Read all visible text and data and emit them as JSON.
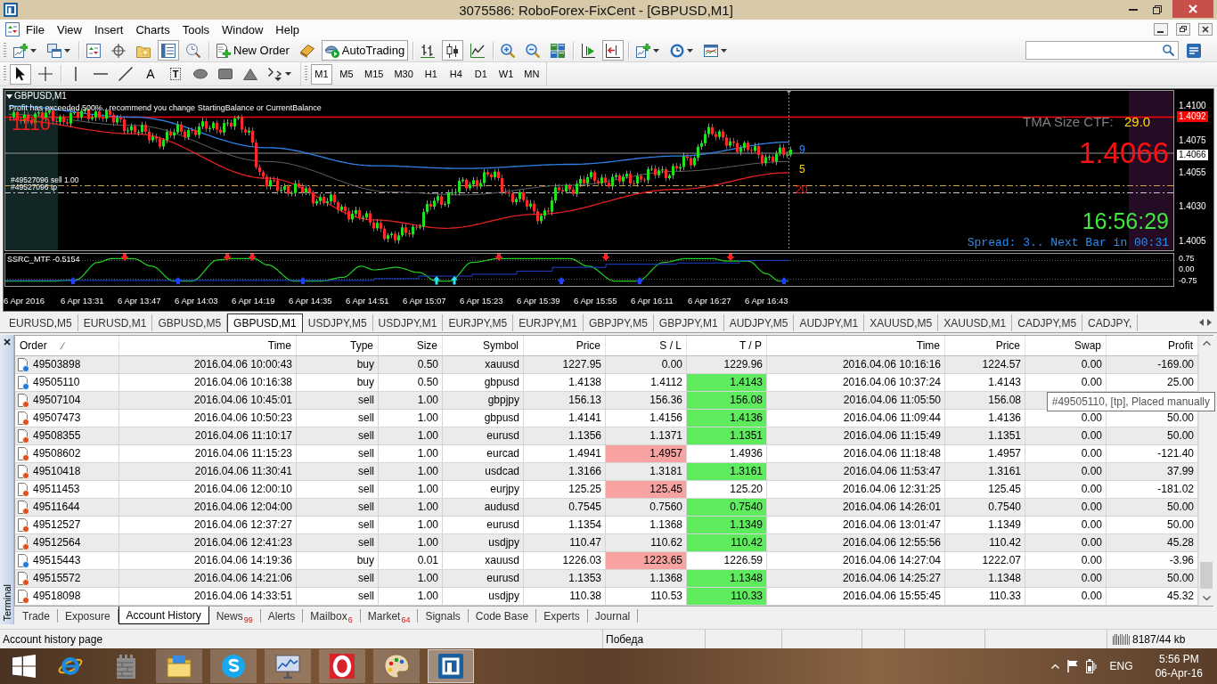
{
  "window": {
    "title": "3075586: RoboForex-FixCent - [GBPUSD,M1]"
  },
  "menu": [
    "File",
    "View",
    "Insert",
    "Charts",
    "Tools",
    "Window",
    "Help"
  ],
  "toolbar": [
    {
      "kind": "new-chart",
      "pressed": false
    },
    {
      "kind": "profiles",
      "pressed": false
    },
    {
      "kind": "separator"
    },
    {
      "kind": "market-watch",
      "pressed": false
    },
    {
      "kind": "navigator",
      "pressed": false
    },
    {
      "kind": "favorites",
      "pressed": false
    },
    {
      "kind": "terminal",
      "pressed": true
    },
    {
      "kind": "tester",
      "pressed": false
    },
    {
      "kind": "separator"
    },
    {
      "kind": "new-order",
      "label": "New Order",
      "pressed": false
    },
    {
      "kind": "editor",
      "pressed": false
    },
    {
      "kind": "autotrading",
      "label": "AutoTrading",
      "pressed": true
    },
    {
      "kind": "separator"
    },
    {
      "kind": "bar-chart",
      "pressed": false
    },
    {
      "kind": "candle-chart",
      "pressed": true
    },
    {
      "kind": "line-chart",
      "pressed": false
    },
    {
      "kind": "separator"
    },
    {
      "kind": "zoom-in",
      "pressed": false
    },
    {
      "kind": "zoom-out",
      "pressed": false
    },
    {
      "kind": "tile",
      "pressed": false
    },
    {
      "kind": "separator"
    },
    {
      "kind": "autoscroll",
      "pressed": false
    },
    {
      "kind": "chart-shift",
      "pressed": true
    },
    {
      "kind": "separator"
    },
    {
      "kind": "indicators",
      "pressed": false
    },
    {
      "kind": "periods",
      "pressed": false
    },
    {
      "kind": "templates",
      "pressed": false
    }
  ],
  "drawing_tools": [
    {
      "kind": "cursor",
      "pressed": true
    },
    {
      "kind": "crosshair",
      "pressed": false
    },
    {
      "kind": "separator"
    },
    {
      "kind": "vline",
      "pressed": false
    },
    {
      "kind": "hline",
      "pressed": false
    },
    {
      "kind": "trendline",
      "pressed": false
    },
    {
      "kind": "text",
      "label": "A",
      "pressed": false
    },
    {
      "kind": "label",
      "label": "T",
      "pressed": false
    },
    {
      "kind": "ellipse",
      "pressed": false
    },
    {
      "kind": "rectangle",
      "pressed": false
    },
    {
      "kind": "triangle",
      "pressed": false
    },
    {
      "kind": "arrows",
      "pressed": false
    }
  ],
  "timeframes": [
    {
      "label": "M1",
      "selected": true
    },
    {
      "label": "M5",
      "selected": false
    },
    {
      "label": "M15",
      "selected": false
    },
    {
      "label": "M30",
      "selected": false
    },
    {
      "label": "H1",
      "selected": false
    },
    {
      "label": "H4",
      "selected": false
    },
    {
      "label": "D1",
      "selected": false
    },
    {
      "label": "W1",
      "selected": false
    },
    {
      "label": "MN",
      "selected": false
    }
  ],
  "chart": {
    "symbol": "GBPUSD,M1",
    "message": "Profit has exceeded 500%...recommend you change StartingBalance or CurrentBalance",
    "corner_value": "1110",
    "order_labels": [
      "#49527096 sell 1.00",
      "#49527096 tp"
    ],
    "ma_labels": [
      {
        "text": "9",
        "color": "#3a8ee8"
      },
      {
        "text": "5",
        "color": "#f0d020"
      },
      {
        "text": "20",
        "color": "#e82020"
      }
    ],
    "tma_label": "TMA Size CTF:",
    "tma_value": "29.0",
    "price": "1.4066",
    "clock": "16:56:29",
    "spread": "Spread: 3.. Next Bar in 00:31",
    "price_axis": [
      {
        "text": "1.4100",
        "kind": "tick"
      },
      {
        "text": "1.4092",
        "kind": "line"
      },
      {
        "text": "1.4075",
        "kind": "tick"
      },
      {
        "text": "1.4066",
        "kind": "bid"
      },
      {
        "text": "1.4055",
        "kind": "tick"
      },
      {
        "text": "1.4030",
        "kind": "tick"
      },
      {
        "text": "1.4005",
        "kind": "tick"
      }
    ],
    "indicator": {
      "name": "SSRC_MTF -0.5154",
      "axis": [
        "0.75",
        "0.00",
        "-0.75"
      ]
    },
    "time_axis": [
      "6 Apr 2016",
      "6 Apr 13:31",
      "6 Apr 13:47",
      "6 Apr 14:03",
      "6 Apr 14:19",
      "6 Apr 14:35",
      "6 Apr 14:51",
      "6 Apr 15:07",
      "6 Apr 15:23",
      "6 Apr 15:39",
      "6 Apr 15:55",
      "6 Apr 16:11",
      "6 Apr 16:27",
      "6 Apr 16:43"
    ]
  },
  "chart_tabs": [
    {
      "label": "EURUSD,M5",
      "selected": false
    },
    {
      "label": "EURUSD,M1",
      "selected": false
    },
    {
      "label": "GBPUSD,M5",
      "selected": false
    },
    {
      "label": "GBPUSD,M1",
      "selected": true
    },
    {
      "label": "USDJPY,M5",
      "selected": false
    },
    {
      "label": "USDJPY,M1",
      "selected": false
    },
    {
      "label": "EURJPY,M5",
      "selected": false
    },
    {
      "label": "EURJPY,M1",
      "selected": false
    },
    {
      "label": "GBPJPY,M5",
      "selected": false
    },
    {
      "label": "GBPJPY,M1",
      "selected": false
    },
    {
      "label": "AUDJPY,M5",
      "selected": false
    },
    {
      "label": "AUDJPY,M1",
      "selected": false
    },
    {
      "label": "XAUUSD,M5",
      "selected": false
    },
    {
      "label": "XAUUSD,M1",
      "selected": false
    },
    {
      "label": "CADJPY,M5",
      "selected": false
    },
    {
      "label": "CADJPY,",
      "selected": false
    }
  ],
  "terminal": {
    "title": "Terminal",
    "columns": [
      "Order",
      "Time",
      "Type",
      "Size",
      "Symbol",
      "Price",
      "S / L",
      "T / P",
      "Time",
      "Price",
      "Swap",
      "Profit"
    ],
    "rows": [
      {
        "kind": "buy",
        "order": "49503898",
        "open_time": "2016.04.06 10:00:43",
        "type": "buy",
        "size": "0.50",
        "symbol": "xauusd",
        "open_price": "1227.95",
        "sl": "0.00",
        "sl_hit": false,
        "tp": "1229.96",
        "tp_hit": false,
        "close_time": "2016.04.06 10:16:16",
        "close_price": "1224.57",
        "swap": "0.00",
        "profit": "-169.00"
      },
      {
        "kind": "buy",
        "order": "49505110",
        "open_time": "2016.04.06 10:16:38",
        "type": "buy",
        "size": "0.50",
        "symbol": "gbpusd",
        "open_price": "1.4138",
        "sl": "1.4112",
        "sl_hit": false,
        "tp": "1.4143",
        "tp_hit": true,
        "close_time": "2016.04.06 10:37:24",
        "close_price": "1.4143",
        "swap": "0.00",
        "profit": "25.00"
      },
      {
        "kind": "sell",
        "order": "49507104",
        "open_time": "2016.04.06 10:45:01",
        "type": "sell",
        "size": "1.00",
        "symbol": "gbpjpy",
        "open_price": "156.13",
        "sl": "156.36",
        "sl_hit": false,
        "tp": "156.08",
        "tp_hit": true,
        "close_time": "2016.04.06 11:05:50",
        "close_price": "156.08"
      },
      {
        "kind": "sell",
        "order": "49507473",
        "open_time": "2016.04.06 10:50:23",
        "type": "sell",
        "size": "1.00",
        "symbol": "gbpusd",
        "open_price": "1.4141",
        "sl": "1.4156",
        "sl_hit": false,
        "tp": "1.4136",
        "tp_hit": true,
        "close_time": "2016.04.06 11:09:44",
        "close_price": "1.4136",
        "swap": "0.00",
        "profit": "50.00"
      },
      {
        "kind": "sell",
        "order": "49508355",
        "open_time": "2016.04.06 11:10:17",
        "type": "sell",
        "size": "1.00",
        "symbol": "eurusd",
        "open_price": "1.1356",
        "sl": "1.1371",
        "sl_hit": false,
        "tp": "1.1351",
        "tp_hit": true,
        "close_time": "2016.04.06 11:15:49",
        "close_price": "1.1351",
        "swap": "0.00",
        "profit": "50.00"
      },
      {
        "kind": "sell",
        "order": "49508602",
        "open_time": "2016.04.06 11:15:23",
        "type": "sell",
        "size": "1.00",
        "symbol": "eurcad",
        "open_price": "1.4941",
        "sl": "1.4957",
        "sl_hit": true,
        "tp": "1.4936",
        "tp_hit": false,
        "close_time": "2016.04.06 11:18:48",
        "close_price": "1.4957",
        "swap": "0.00",
        "profit": "-121.40"
      },
      {
        "kind": "sell",
        "order": "49510418",
        "open_time": "2016.04.06 11:30:41",
        "type": "sell",
        "size": "1.00",
        "symbol": "usdcad",
        "open_price": "1.3166",
        "sl": "1.3181",
        "sl_hit": false,
        "tp": "1.3161",
        "tp_hit": true,
        "close_time": "2016.04.06 11:53:47",
        "close_price": "1.3161",
        "swap": "0.00",
        "profit": "37.99"
      },
      {
        "kind": "sell",
        "order": "49511453",
        "open_time": "2016.04.06 12:00:10",
        "type": "sell",
        "size": "1.00",
        "symbol": "eurjpy",
        "open_price": "125.25",
        "sl": "125.45",
        "sl_hit": true,
        "tp": "125.20",
        "tp_hit": false,
        "close_time": "2016.04.06 12:31:25",
        "close_price": "125.45",
        "swap": "0.00",
        "profit": "-181.02"
      },
      {
        "kind": "sell",
        "order": "49511644",
        "open_time": "2016.04.06 12:04:00",
        "type": "sell",
        "size": "1.00",
        "symbol": "audusd",
        "open_price": "0.7545",
        "sl": "0.7560",
        "sl_hit": false,
        "tp": "0.7540",
        "tp_hit": true,
        "close_time": "2016.04.06 14:26:01",
        "close_price": "0.7540",
        "swap": "0.00",
        "profit": "50.00"
      },
      {
        "kind": "sell",
        "order": "49512527",
        "open_time": "2016.04.06 12:37:27",
        "type": "sell",
        "size": "1.00",
        "symbol": "eurusd",
        "open_price": "1.1354",
        "sl": "1.1368",
        "sl_hit": false,
        "tp": "1.1349",
        "tp_hit": true,
        "close_time": "2016.04.06 13:01:47",
        "close_price": "1.1349",
        "swap": "0.00",
        "profit": "50.00"
      },
      {
        "kind": "sell",
        "order": "49512564",
        "open_time": "2016.04.06 12:41:23",
        "type": "sell",
        "size": "1.00",
        "symbol": "usdjpy",
        "open_price": "110.47",
        "sl": "110.62",
        "sl_hit": false,
        "tp": "110.42",
        "tp_hit": true,
        "close_time": "2016.04.06 12:55:56",
        "close_price": "110.42",
        "swap": "0.00",
        "profit": "45.28"
      },
      {
        "kind": "buy",
        "order": "49515443",
        "open_time": "2016.04.06 14:19:36",
        "type": "buy",
        "size": "0.01",
        "symbol": "xauusd",
        "open_price": "1226.03",
        "sl": "1223.65",
        "sl_hit": true,
        "tp": "1226.59",
        "tp_hit": false,
        "close_time": "2016.04.06 14:27:04",
        "close_price": "1222.07",
        "swap": "0.00",
        "profit": "-3.96"
      },
      {
        "kind": "sell",
        "order": "49515572",
        "open_time": "2016.04.06 14:21:06",
        "type": "sell",
        "size": "1.00",
        "symbol": "eurusd",
        "open_price": "1.1353",
        "sl": "1.1368",
        "sl_hit": false,
        "tp": "1.1348",
        "tp_hit": true,
        "close_time": "2016.04.06 14:25:27",
        "close_price": "1.1348",
        "swap": "0.00",
        "profit": "50.00"
      },
      {
        "kind": "sell",
        "order": "49518098",
        "open_time": "2016.04.06 14:33:51",
        "type": "sell",
        "size": "1.00",
        "symbol": "usdjpy",
        "open_price": "110.38",
        "sl": "110.53",
        "sl_hit": false,
        "tp": "110.33",
        "tp_hit": true,
        "close_time": "2016.04.06 15:55:45",
        "close_price": "110.33",
        "swap": "0.00",
        "profit": "45.32"
      }
    ],
    "tooltip": "#49505110, [tp], Placed manually",
    "tabs": [
      {
        "label": "Trade",
        "selected": false
      },
      {
        "label": "Exposure",
        "selected": false
      },
      {
        "label": "Account History",
        "selected": true
      },
      {
        "label": "News",
        "count": "99",
        "selected": false
      },
      {
        "label": "Alerts",
        "selected": false
      },
      {
        "label": "Mailbox",
        "count": "6",
        "selected": false
      },
      {
        "label": "Market",
        "count": "64",
        "selected": false
      },
      {
        "label": "Signals",
        "selected": false
      },
      {
        "label": "Code Base",
        "selected": false
      },
      {
        "label": "Experts",
        "selected": false
      },
      {
        "label": "Journal",
        "selected": false
      }
    ]
  },
  "status_bar": {
    "text": "Account history page",
    "server": "Победа",
    "traffic": "8187/44 kb"
  },
  "taskbar": {
    "apps": [
      {
        "kind": "browser",
        "running": false,
        "active": false
      },
      {
        "kind": "tower",
        "running": false,
        "active": false
      },
      {
        "kind": "files",
        "running": true,
        "active": false
      },
      {
        "kind": "messenger",
        "running": true,
        "active": false
      },
      {
        "kind": "monitor",
        "running": true,
        "active": false
      },
      {
        "kind": "ring",
        "running": true,
        "active": false
      },
      {
        "kind": "paint",
        "running": true,
        "active": false
      },
      {
        "kind": "trader",
        "running": true,
        "active": true
      }
    ],
    "language": "ENG",
    "time": "5:56 PM",
    "date": "06-Apr-16"
  }
}
